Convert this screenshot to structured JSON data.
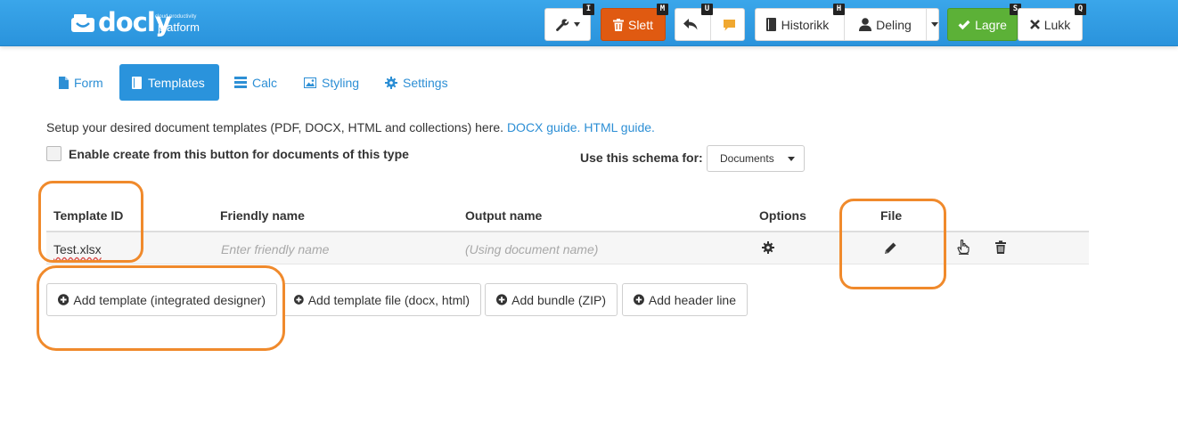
{
  "brand": {
    "logo_word": "docly",
    "tagline": "cloud productivity",
    "platform": "platform"
  },
  "toolbar": {
    "tools_shortcut": "I",
    "delete_label": "Slett",
    "delete_shortcut": "M",
    "undo_shortcut": "U",
    "history_label": "Historikk",
    "history_shortcut": "H",
    "share_label": "Deling",
    "save_label": "Lagre",
    "save_shortcut": "S",
    "close_label": "Lukk",
    "close_shortcut": "Q"
  },
  "tabs": [
    {
      "label": "Form",
      "icon": "file-icon"
    },
    {
      "label": "Templates",
      "icon": "book-icon"
    },
    {
      "label": "Calc",
      "icon": "tasks-icon"
    },
    {
      "label": "Styling",
      "icon": "picture-icon"
    },
    {
      "label": "Settings",
      "icon": "gear-icon"
    }
  ],
  "intro": {
    "text": "Setup your desired document templates (PDF, DOCX, HTML and collections) here.",
    "docx_link": "DOCX guide.",
    "html_link": "HTML guide."
  },
  "enable_create_label": "Enable create from this button for documents of this type",
  "schema": {
    "label": "Use this schema for:",
    "selected": "Documents"
  },
  "table": {
    "headers": [
      "Template ID",
      "Friendly name",
      "Output name",
      "Options",
      "File"
    ],
    "rows": [
      {
        "template_id": "Test.xlsx",
        "friendly_placeholder": "Enter friendly name",
        "output_placeholder": "(Using document name)"
      }
    ]
  },
  "add_buttons": [
    "Add template (integrated designer)",
    "Add template file (docx, html)",
    "Add bundle (ZIP)",
    "Add header line"
  ],
  "colors": {
    "topbar": "#2a93dc",
    "danger": "#e05a11",
    "success": "#5cb137",
    "link": "#2d8fd5",
    "annotation": "#f08a2c"
  }
}
